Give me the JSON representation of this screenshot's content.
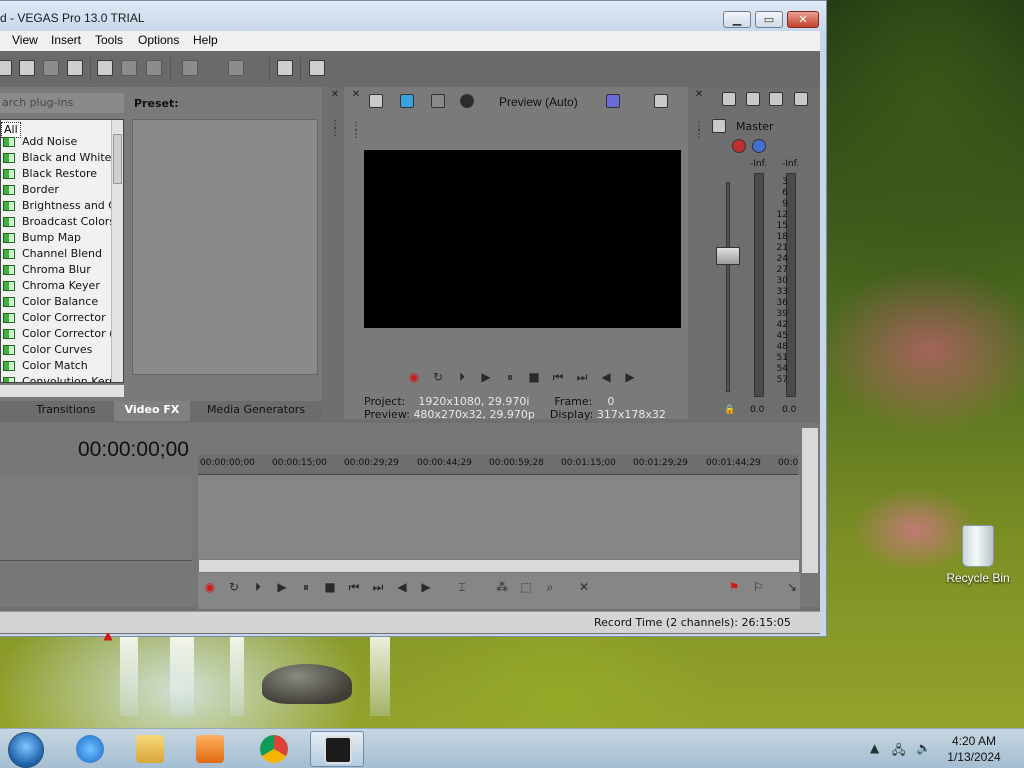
{
  "window": {
    "title": "d - VEGAS Pro 13.0 TRIAL",
    "caption_buttons": [
      "minimize",
      "maximize",
      "close"
    ]
  },
  "menu": [
    "View",
    "Insert",
    "Tools",
    "Options",
    "Help"
  ],
  "plugin_panel": {
    "search_placeholder": "arch plug-ins",
    "preset_label": "Preset:",
    "category_selected": "All",
    "items": [
      "Add Noise",
      "Black and White",
      "Black Restore",
      "Border",
      "Brightness and Contrast",
      "Broadcast Colors",
      "Bump Map",
      "Channel Blend",
      "Chroma Blur",
      "Chroma Keyer",
      "Color Balance",
      "Color Corrector",
      "Color Corrector (Secondary)",
      "Color Curves",
      "Color Match",
      "Convolution Kernel"
    ],
    "tabs": [
      "Transitions",
      "Video FX",
      "Media Generators"
    ],
    "active_tab": "Video FX"
  },
  "preview": {
    "mode_label": "Preview (Auto)",
    "project_label": "Project:",
    "project_value": "1920x1080, 29.970i",
    "preview_label": "Preview:",
    "preview_value": "480x270x32, 29.970p",
    "frame_label": "Frame:",
    "frame_value": "0",
    "display_label": "Display:",
    "display_value": "317x178x32"
  },
  "mixer": {
    "label": "Master",
    "peak_left": "-Inf.",
    "peak_right": "-Inf.",
    "level_left": "0.0",
    "level_right": "0.0",
    "scale": [
      "3",
      "6",
      "9",
      "12",
      "15",
      "18",
      "21",
      "24",
      "27",
      "30",
      "33",
      "36",
      "39",
      "42",
      "45",
      "48",
      "51",
      "54",
      "57"
    ]
  },
  "timeline": {
    "timecode": "00:00:00;00",
    "ruler": [
      "00:00:00;00",
      "00:00:15;00",
      "00:00:29;29",
      "00:00:44;29",
      "00:00:59;28",
      "00:01:15;00",
      "00:01:29;29",
      "00:01:44;29",
      "00:0"
    ]
  },
  "status": {
    "record_time": "Record Time (2 channels): 26:15:05"
  },
  "desktop": {
    "recycle_bin_label": "Recycle Bin"
  },
  "taskbar": {
    "time": "4:20 AM",
    "date": "1/13/2024",
    "apps": [
      "internet-explorer",
      "file-explorer",
      "media-player",
      "chrome",
      "vegas-pro"
    ]
  },
  "colors": {
    "panel_bg": "#7a7a7a",
    "record_red": "#d01a1a",
    "titlebar": "#c6d6ea"
  }
}
